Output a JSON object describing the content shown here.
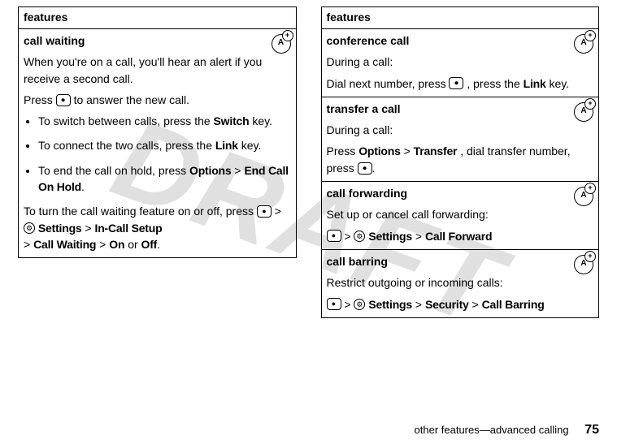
{
  "watermark": "DRAFT",
  "left": {
    "header": "features",
    "row": {
      "title": "call waiting",
      "intro": "When you're on a call, you'll hear an alert if you receive a second call.",
      "press_prefix": "Press ",
      "press_key_glyph": "⏺",
      "press_suffix": " to answer the new call.",
      "b1_text": "To switch between calls, press the ",
      "b1_key": "Switch",
      "b1_suffix": " key.",
      "b2_text": "To connect the two calls, press the ",
      "b2_key": "Link",
      "b2_suffix": " key.",
      "b3_text": "To end the call on hold, press ",
      "b3_opt": "Options",
      "gt": ">",
      "b3_target": "End Call On Hold",
      "b3_period": ".",
      "toggle_intro": "To turn the call waiting feature on or off, press ",
      "toggle_key_glyph": "●",
      "settings": "Settings",
      "incall": "In-Call Setup",
      "callwaiting": "Call Waiting",
      "on": "On",
      "or": " or ",
      "off": "Off",
      "final_period": "."
    }
  },
  "right": {
    "header": "features",
    "rows": [
      {
        "title": "conference call",
        "l1": "During a call:",
        "l2a": "Dial next number, press ",
        "key_glyph": "⏺",
        "l2b": ", press the ",
        "link": "Link",
        "l2c": " key."
      },
      {
        "title": "transfer a call",
        "l1": "During a call:",
        "press": "Press ",
        "options": "Options",
        "gt": ">",
        "transfer": "Transfer",
        "l2b": ", dial transfer number, press ",
        "key_glyph": "⏺",
        "period": "."
      },
      {
        "title": "call forwarding",
        "l1": "Set up or cancel call forwarding:",
        "key_glyph": "●",
        "gt": ">",
        "gear_glyph": "✲",
        "settings": "Settings",
        "target": "Call Forward"
      },
      {
        "title": "call barring",
        "l1": "Restrict outgoing or incoming calls:",
        "key_glyph": "●",
        "gt": ">",
        "gear_glyph": "✲",
        "settings": "Settings",
        "security": "Security",
        "target": "Call Barring"
      }
    ]
  },
  "footer": {
    "section": "other features—advanced calling",
    "page": "75"
  }
}
